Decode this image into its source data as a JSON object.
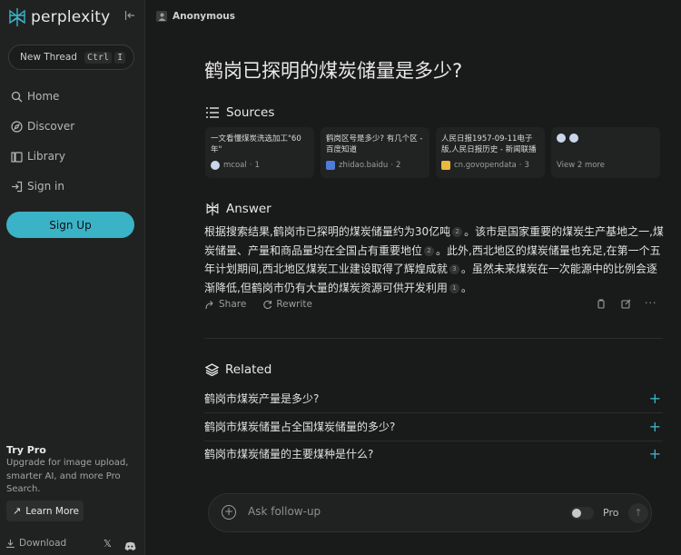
{
  "sidebar": {
    "logo_text": "perplexity",
    "new_thread_label": "New Thread",
    "shortcut_key1": "Ctrl",
    "shortcut_key2": "I",
    "nav": [
      {
        "label": "Home",
        "icon": "search-icon"
      },
      {
        "label": "Discover",
        "icon": "compass-icon"
      },
      {
        "label": "Library",
        "icon": "library-icon"
      },
      {
        "label": "Sign in",
        "icon": "sign-in-icon"
      }
    ],
    "signup_label": "Sign Up",
    "trypro_title": "Try Pro",
    "trypro_desc": "Upgrade for image upload, smarter AI, and more Pro Search.",
    "learn_more_label": "Learn More",
    "download_label": "Download",
    "accent_color": "#3bb3c7"
  },
  "topbar": {
    "user_label": "Anonymous"
  },
  "thread": {
    "title": "鹤岗已探明的煤炭储量是多少?",
    "sources_heading": "Sources",
    "sources": [
      {
        "title": "一文看懂煤炭洗选加工\"60年\"",
        "site": "mcoal",
        "index": "1"
      },
      {
        "title": "鹤岗区号是多少? 有几个区 - 百度知道",
        "site": "zhidao.baidu",
        "index": "2"
      },
      {
        "title": "人民日报1957-09-11电子版,人民日报历史 - 新闻联播",
        "site": "cn.govopendata",
        "index": "3"
      }
    ],
    "view_more_label": "View 2 more",
    "answer_heading": "Answer",
    "answer_parts": [
      "根据搜索结果,鹤岗市已探明的煤炭储量约为30亿吨",
      "2",
      "。该市是国家重要的煤炭生产基地之一,煤炭储量、产量和商品量均在全国占有重要地位",
      "2",
      "。此外,西北地区的煤炭储量也充足,在第一个五年计划期间,西北地区煤炭工业建设取得了辉煌成就",
      "3",
      "。虽然未来煤炭在一次能源中的比例会逐渐降低,但鹤岗市仍有大量的煤炭资源可供开发利用",
      "1",
      "。"
    ],
    "share_label": "Share",
    "rewrite_label": "Rewrite",
    "related_heading": "Related",
    "related": [
      "鹤岗市煤炭产量是多少?",
      "鹤岗市煤炭储量占全国煤炭储量的多少?",
      "鹤岗市煤炭储量的主要煤种是什么?"
    ]
  },
  "followup": {
    "placeholder": "Ask follow-up",
    "pro_label": "Pro"
  }
}
